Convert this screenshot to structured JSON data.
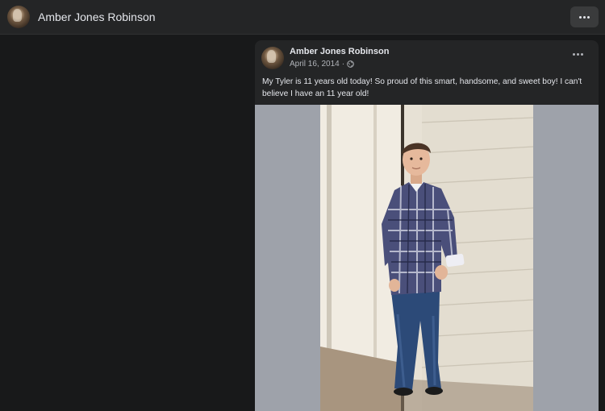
{
  "header": {
    "profile_name": "Amber Jones Robinson",
    "avatar_icon": "profile-photo",
    "more_icon": "more-horizontal-icon"
  },
  "post": {
    "author": "Amber Jones Robinson",
    "date": "April 16, 2014",
    "separator": "·",
    "privacy_icon": "globe-icon",
    "menu_icon": "more-horizontal-icon",
    "text": "My Tyler is 11 years old today! So proud of this smart, handsome, and sweet boy! I can't believe I have an 11 year old!",
    "photo": "boy in plaid shirt and jeans leaning against white garage door"
  },
  "colors": {
    "background": "#18191a",
    "surface": "#242526",
    "text_primary": "#e4e6eb",
    "text_secondary": "#b0b3b8",
    "photo_letterbox": "#9ea2aa"
  }
}
